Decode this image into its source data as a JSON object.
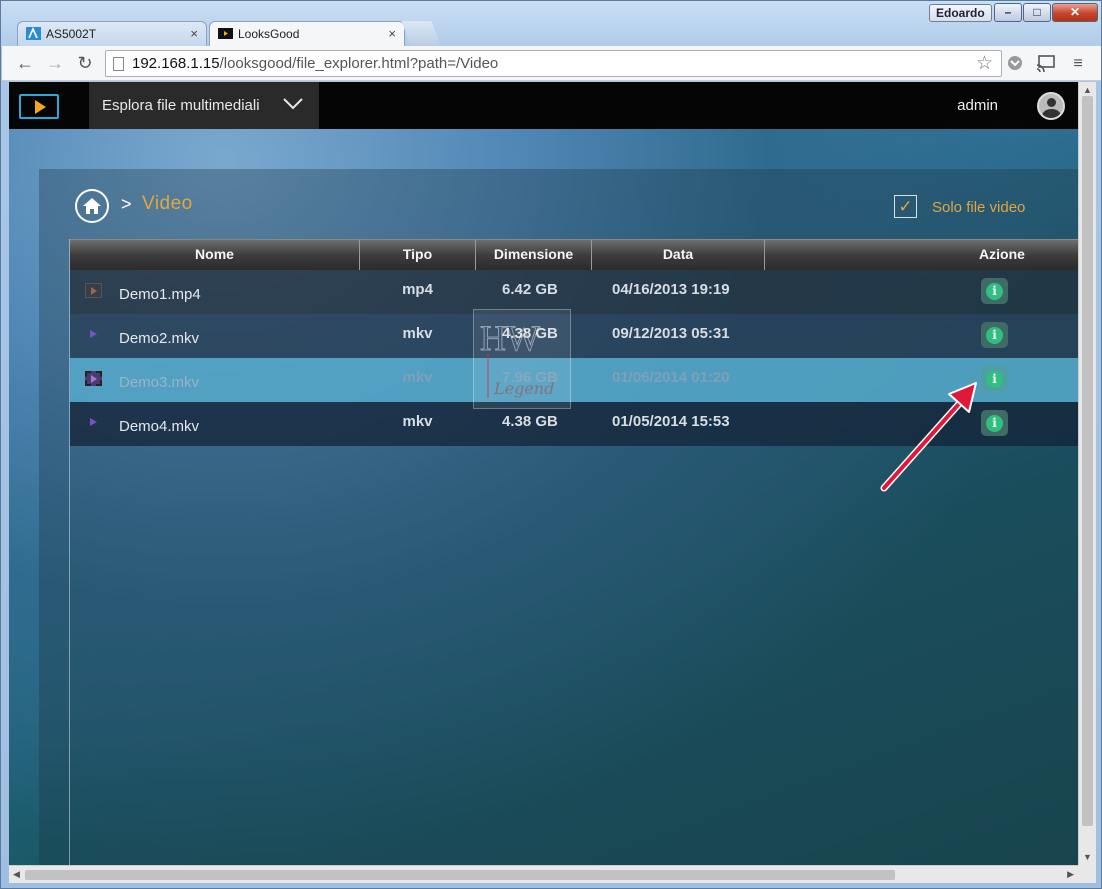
{
  "window": {
    "user": "Edoardo"
  },
  "tabs": [
    {
      "label": "AS5002T",
      "active": false
    },
    {
      "label": "LooksGood",
      "active": true
    }
  ],
  "toolbar": {
    "url_host": "192.168.1.15",
    "url_path": "/looksgood/file_explorer.html?path=/Video"
  },
  "app": {
    "menu_label": "Esplora file multimediali",
    "user": "admin"
  },
  "breadcrumb": {
    "separator": ">",
    "current": "Video"
  },
  "filter": {
    "checked": true,
    "check_glyph": "✓",
    "label": "Solo file video"
  },
  "table": {
    "columns": [
      "Nome",
      "Tipo",
      "Dimensione",
      "Data",
      "Azione"
    ],
    "rows": [
      {
        "name": "Demo1.mp4",
        "type": "mp4",
        "size": "6.42  GB",
        "date": "04/16/2013 19:19",
        "icon": "video-file-icon"
      },
      {
        "name": "Demo2.mkv",
        "type": "mkv",
        "size": "4.38  GB",
        "date": "09/12/2013 05:31",
        "icon": "play-icon"
      },
      {
        "name": "Demo3.mkv",
        "type": "mkv",
        "size": "7.96  GB",
        "date": "01/06/2014 01:20",
        "icon": "film-icon"
      },
      {
        "name": "Demo4.mkv",
        "type": "mkv",
        "size": "4.38  GB",
        "date": "01/05/2014 15:53",
        "icon": "play-icon"
      }
    ],
    "selected_row": 2,
    "action_glyph": "i"
  },
  "colors": {
    "accent": "#e0a640",
    "info_green": "#2fbf7f",
    "selected_row": "#56aacd"
  },
  "watermark": {
    "top": "HW",
    "bottom": "Legend"
  }
}
